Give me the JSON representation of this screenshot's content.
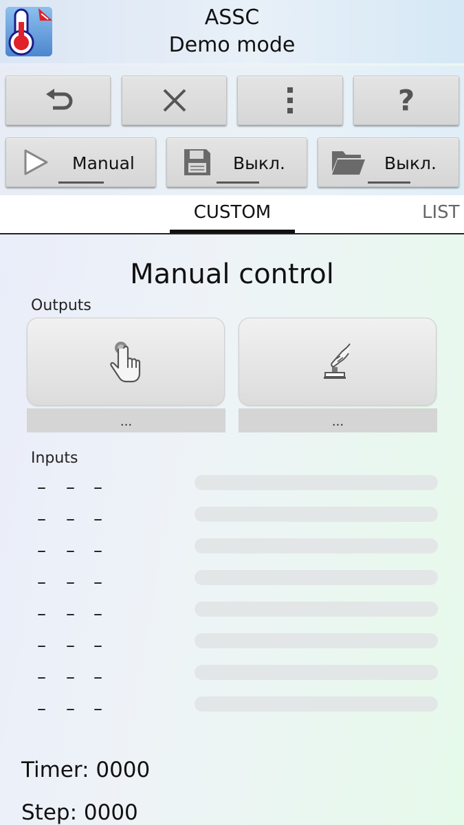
{
  "header": {
    "title": "ASSC",
    "subtitle": "Demo mode"
  },
  "toolbar": {
    "icons": [
      "undo-icon",
      "close-icon",
      "more-vert-icon",
      "help-icon"
    ],
    "help_glyph": "?",
    "mode_label": "Manual",
    "save_label": "Выкл.",
    "open_label": "Выкл."
  },
  "tabs": {
    "active": "CUSTOM",
    "next": "LIST"
  },
  "main": {
    "title": "Manual control",
    "outputs_label": "Outputs",
    "outputs": [
      {
        "icon": "hand-pointer-icon",
        "caption": "..."
      },
      {
        "icon": "hand-press-switch-icon",
        "caption": "..."
      }
    ],
    "inputs_label": "Inputs",
    "inputs": [
      [
        "–",
        "–",
        "–"
      ],
      [
        "–",
        "–",
        "–"
      ],
      [
        "–",
        "–",
        "–"
      ],
      [
        "–",
        "–",
        "–"
      ],
      [
        "–",
        "–",
        "–"
      ],
      [
        "–",
        "–",
        "–"
      ],
      [
        "–",
        "–",
        "–"
      ],
      [
        "–",
        "–",
        "–"
      ]
    ]
  },
  "status": {
    "timer": "Timer: 0000",
    "step": "Step: 0000"
  },
  "colors": {
    "brand_red": "#e0202a",
    "brand_blue": "#1a55c8",
    "bar_gray": "#e3e6e6",
    "button_gray": "#d9d9d9"
  }
}
